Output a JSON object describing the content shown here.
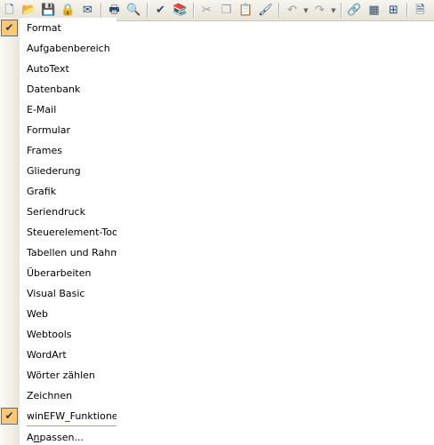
{
  "toolbar": {
    "buttons": [
      {
        "name": "new-document-icon",
        "glyph": "🗋"
      },
      {
        "name": "open-icon",
        "glyph": "📂"
      },
      {
        "name": "save-icon",
        "glyph": "💾"
      },
      {
        "name": "permission-icon",
        "glyph": "🔒"
      },
      {
        "name": "email-icon",
        "glyph": "✉"
      },
      {
        "name": "print-icon",
        "glyph": "🖶"
      },
      {
        "name": "print-preview-icon",
        "glyph": "🔍"
      },
      {
        "name": "spelling-icon",
        "glyph": "✔"
      },
      {
        "name": "research-icon",
        "glyph": "📚"
      },
      {
        "name": "cut-icon",
        "glyph": "✂"
      },
      {
        "name": "copy-icon",
        "glyph": "❐"
      },
      {
        "name": "paste-icon",
        "glyph": "📋"
      },
      {
        "name": "format-painter-icon",
        "glyph": "🖌"
      },
      {
        "name": "undo-icon",
        "glyph": "↶"
      },
      {
        "name": "redo-icon",
        "glyph": "↷"
      },
      {
        "name": "insert-hyperlink-icon",
        "glyph": "🔗"
      },
      {
        "name": "tables-borders-icon",
        "glyph": "▦"
      },
      {
        "name": "insert-table-icon",
        "glyph": "▤"
      },
      {
        "name": "insert-excel-icon",
        "glyph": "⊞"
      },
      {
        "name": "document-map-icon",
        "glyph": "🗎"
      }
    ]
  },
  "menu": {
    "items": [
      {
        "label": "Format",
        "checked": true
      },
      {
        "label": "Aufgabenbereich",
        "checked": false
      },
      {
        "label": "AutoText",
        "checked": false
      },
      {
        "label": "Datenbank",
        "checked": false
      },
      {
        "label": "E-Mail",
        "checked": false
      },
      {
        "label": "Formular",
        "checked": false
      },
      {
        "label": "Frames",
        "checked": false
      },
      {
        "label": "Gliederung",
        "checked": false
      },
      {
        "label": "Grafik",
        "checked": false
      },
      {
        "label": "Seriendruck",
        "checked": false
      },
      {
        "label": "Steuerelement-Toolbox",
        "checked": false
      },
      {
        "label": "Tabellen und Rahmen",
        "checked": false
      },
      {
        "label": "Überarbeiten",
        "checked": false
      },
      {
        "label": "Visual Basic",
        "checked": false
      },
      {
        "label": "Web",
        "checked": false
      },
      {
        "label": "Webtools",
        "checked": false
      },
      {
        "label": "WordArt",
        "checked": false
      },
      {
        "label": "Wörter zählen",
        "checked": false
      },
      {
        "label": "Zeichnen",
        "checked": false
      },
      {
        "label": "winEFW_Funktionen",
        "checked": true
      }
    ],
    "customize_label_before": "A",
    "customize_label_accel": "n",
    "customize_label_after": "passen..."
  },
  "colors": {
    "check_bg": "#ffc973",
    "check_border": "#4b6ea9"
  }
}
